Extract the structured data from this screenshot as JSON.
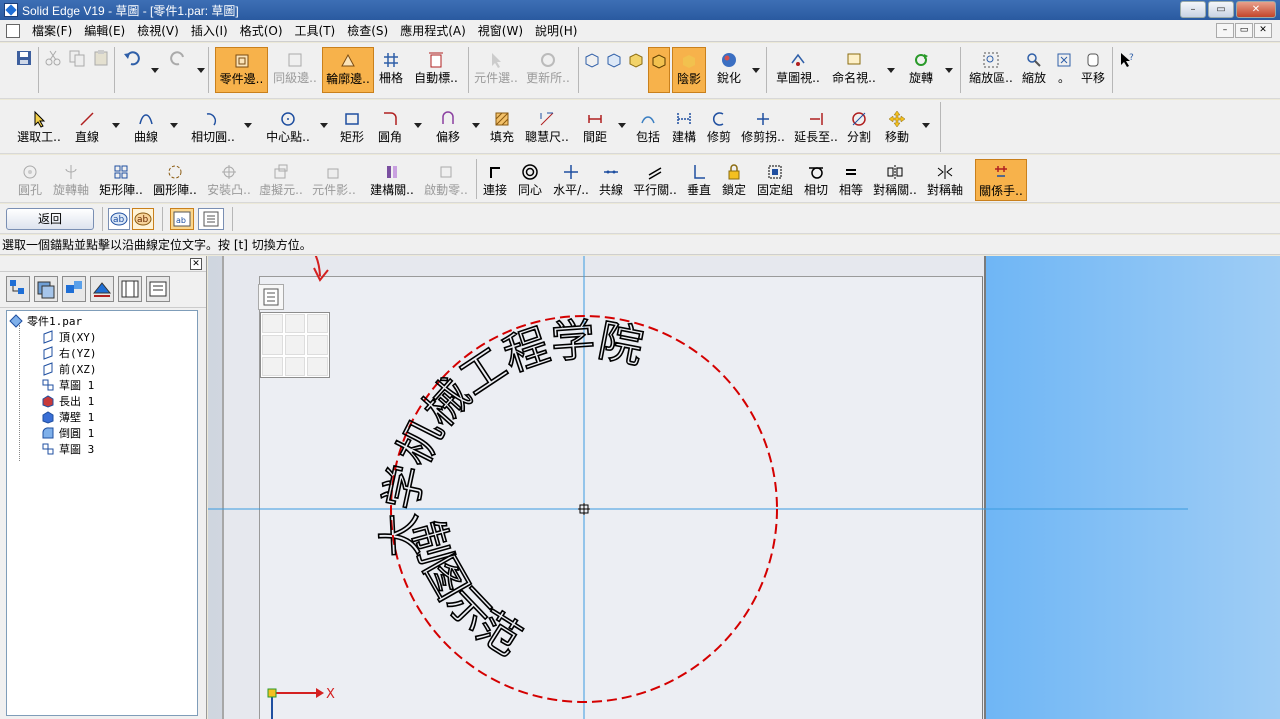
{
  "window": {
    "title": "Solid Edge V19 - 草圖 - [零件1.par: 草圖]",
    "buttons": [
      "–",
      "▭",
      "✕"
    ]
  },
  "menu": {
    "items": [
      "檔案(F)",
      "編輯(E)",
      "檢視(V)",
      "插入(I)",
      "格式(O)",
      "工具(T)",
      "檢查(S)",
      "應用程式(A)",
      "視窗(W)",
      "說明(H)"
    ],
    "mdi_buttons": [
      "–",
      "▭",
      "✕"
    ]
  },
  "toolbar1": {
    "part_edges": "零件邊..",
    "peer_edges": "同級邊..",
    "contour_edges": "輪廓邊..",
    "grid": "柵格",
    "auto_dim": "自動標..",
    "part_select": "元件選..",
    "update_all": "更新所..",
    "shading": "陰影",
    "sharpen": "銳化",
    "sketch_view": "草圖視..",
    "named_view": "命名視..",
    "rotate": "旋轉",
    "zoom_area": "縮放區..",
    "zoom": "縮放",
    "zoom_dot": "。",
    "pan": "平移"
  },
  "toolbar2": {
    "select_tool": "選取工..",
    "line": "直線",
    "curve": "曲線",
    "tangent_arc": "相切圓..",
    "center_point": "中心點..",
    "rectangle": "矩形",
    "fillet": "圓角",
    "offset": "偏移",
    "fill": "填充",
    "smart_dim": "聰慧尺..",
    "distance": "間距",
    "include": "包括",
    "construct": "建構",
    "trim": "修剪",
    "trim_corner": "修剪拐..",
    "extend": "延長至..",
    "split": "分割",
    "move": "移動"
  },
  "toolbar3": {
    "hole": "圓孔",
    "revolve_axis": "旋轉軸",
    "rect_pattern": "矩形陣..",
    "circ_pattern": "圓形陣..",
    "mount_boss": "安裝凸..",
    "virtual_part": "虛擬元..",
    "part_shadow": "元件影..",
    "build_rel": "建構關..",
    "activate_part": "啟動零..",
    "connect": "連接",
    "concentric": "同心",
    "horiz_vert": "水平/..",
    "collinear": "共線",
    "parallel": "平行關..",
    "perpendicular": "垂直",
    "lock": "鎖定",
    "rigid_set": "固定組",
    "tangent": "相切",
    "equal": "相等",
    "symmetric_rel": "對稱關..",
    "symmetric_axis": "對稱軸",
    "rel_handles": "關係手.."
  },
  "toolbar4": {
    "return": "返回"
  },
  "status": {
    "prompt": "選取一個錨點並點擊以沿曲線定位文字。按 [t] 切換方位。"
  },
  "tree": {
    "root": "零件1.par",
    "items": [
      "頂(XY)",
      "右(YZ)",
      "前(XZ)",
      "草圖 1",
      "長出 1",
      "薄壁 1",
      "倒圓 1",
      "草圖 3"
    ]
  },
  "sketch": {
    "text_along_curve": "大学机械工程学院 制图示范",
    "axis_label": "X",
    "circle_color": "#d40000",
    "axis_color": "#3a9be0",
    "arrow_color": "#d42020"
  }
}
